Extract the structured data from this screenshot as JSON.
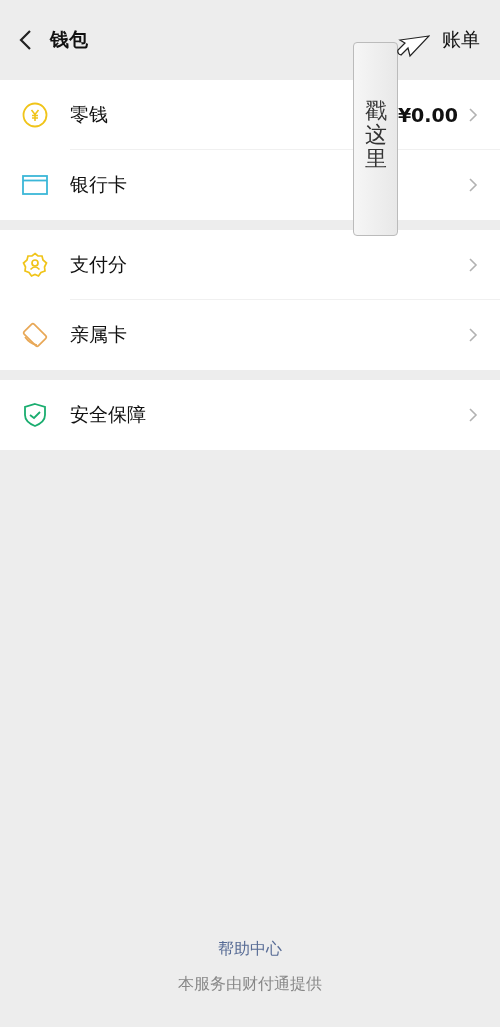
{
  "header": {
    "title": "钱包",
    "action": "账单"
  },
  "groups": [
    {
      "items": [
        {
          "kind": "coin",
          "label": "零钱",
          "value": "¥0.00"
        },
        {
          "kind": "card",
          "label": "银行卡"
        }
      ]
    },
    {
      "items": [
        {
          "kind": "score",
          "label": "支付分"
        },
        {
          "kind": "family",
          "label": "亲属卡"
        }
      ]
    },
    {
      "items": [
        {
          "kind": "shield",
          "label": "安全保障"
        }
      ]
    }
  ],
  "callout": {
    "text": "戳这里"
  },
  "footer": {
    "link": "帮助中心",
    "note": "本服务由财付通提供"
  }
}
